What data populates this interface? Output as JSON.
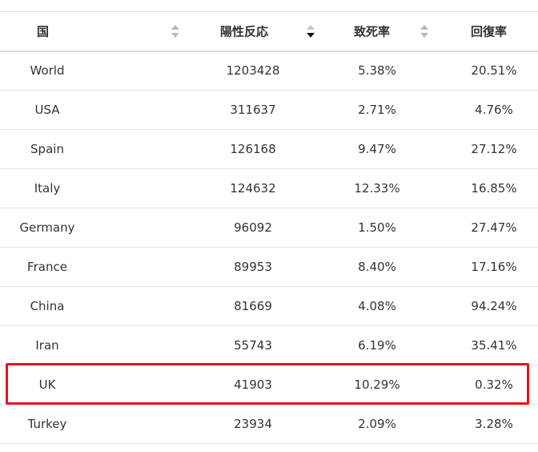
{
  "table": {
    "headers": {
      "country": "国",
      "positive": "陽性反応",
      "death_rate": "致死率",
      "recovery_rate": "回復率"
    },
    "sort": {
      "column": "positive",
      "direction": "desc"
    },
    "rows": [
      {
        "country": "World",
        "positive": "1203428",
        "death_rate": "5.38%",
        "recovery_rate": "20.51%"
      },
      {
        "country": "USA",
        "positive": "311637",
        "death_rate": "2.71%",
        "recovery_rate": "4.76%"
      },
      {
        "country": "Spain",
        "positive": "126168",
        "death_rate": "9.47%",
        "recovery_rate": "27.12%"
      },
      {
        "country": "Italy",
        "positive": "124632",
        "death_rate": "12.33%",
        "recovery_rate": "16.85%"
      },
      {
        "country": "Germany",
        "positive": "96092",
        "death_rate": "1.50%",
        "recovery_rate": "27.47%"
      },
      {
        "country": "France",
        "positive": "89953",
        "death_rate": "8.40%",
        "recovery_rate": "17.16%"
      },
      {
        "country": "China",
        "positive": "81669",
        "death_rate": "4.08%",
        "recovery_rate": "94.24%"
      },
      {
        "country": "Iran",
        "positive": "55743",
        "death_rate": "6.19%",
        "recovery_rate": "35.41%"
      },
      {
        "country": "UK",
        "positive": "41903",
        "death_rate": "10.29%",
        "recovery_rate": "0.32%"
      },
      {
        "country": "Turkey",
        "positive": "23934",
        "death_rate": "2.09%",
        "recovery_rate": "3.28%"
      }
    ],
    "highlighted_row": "UK"
  },
  "colors": {
    "highlight": "#e8121a",
    "sort_active": "#111111",
    "sort_inactive": "#b8b8b8"
  }
}
